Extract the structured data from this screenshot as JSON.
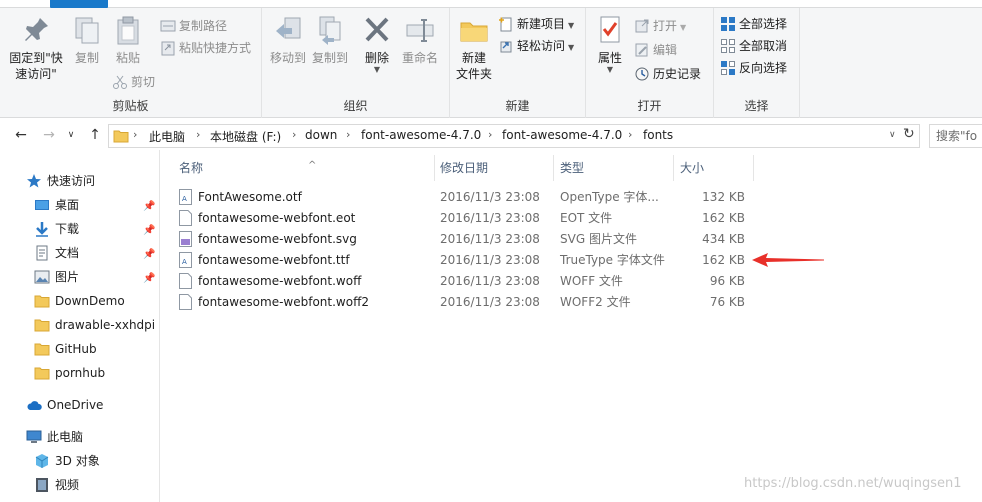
{
  "ribbon": {
    "clipboard": {
      "pin_label_1": "固定到\"快",
      "pin_label_2": "速访问\"",
      "copy_label": "复制",
      "paste_label": "粘贴",
      "copy_path_label": "复制路径",
      "paste_shortcut_label": "粘贴快捷方式",
      "cut_label": "剪切",
      "group_label": "剪贴板"
    },
    "organize": {
      "move_to_label": "移动到",
      "copy_to_label": "复制到",
      "delete_label": "删除",
      "rename_label": "重命名",
      "group_label": "组织"
    },
    "new": {
      "new_folder_label_1": "新建",
      "new_folder_label_2": "文件夹",
      "new_item_label": "新建项目",
      "easy_access_label": "轻松访问",
      "group_label": "新建"
    },
    "open": {
      "properties_label": "属性",
      "open_label": "打开",
      "edit_label": "编辑",
      "history_label": "历史记录",
      "group_label": "打开"
    },
    "select": {
      "select_all_label": "全部选择",
      "select_none_label": "全部取消",
      "invert_label": "反向选择",
      "group_label": "选择"
    }
  },
  "address": {
    "crumbs": [
      "此电脑",
      "本地磁盘 (F:)",
      "down",
      "font-awesome-4.7.0",
      "font-awesome-4.7.0",
      "fonts"
    ],
    "search_placeholder": "搜索\"fo"
  },
  "nav": {
    "quick_access": "快速访问",
    "items": [
      {
        "label": "桌面",
        "pinned": true
      },
      {
        "label": "下载",
        "pinned": true
      },
      {
        "label": "文档",
        "pinned": true
      },
      {
        "label": "图片",
        "pinned": true
      },
      {
        "label": "DownDemo",
        "pinned": false
      },
      {
        "label": "drawable-xxhdpi",
        "pinned": false
      },
      {
        "label": "GitHub",
        "pinned": false
      },
      {
        "label": "pornhub",
        "pinned": false
      }
    ],
    "onedrive": "OneDrive",
    "this_pc": "此电脑",
    "objects3d": "3D 对象",
    "videos": "视频"
  },
  "list": {
    "headers": {
      "name": "名称",
      "date": "修改日期",
      "type": "类型",
      "size": "大小"
    },
    "files": [
      {
        "name": "FontAwesome.otf",
        "date": "2016/11/3 23:08",
        "type": "OpenType 字体...",
        "size": "132 KB",
        "icon": "font-file-icon"
      },
      {
        "name": "fontawesome-webfont.eot",
        "date": "2016/11/3 23:08",
        "type": "EOT 文件",
        "size": "162 KB",
        "icon": "blank-file-icon"
      },
      {
        "name": "fontawesome-webfont.svg",
        "date": "2016/11/3 23:08",
        "type": "SVG 图片文件",
        "size": "434 KB",
        "icon": "svg-file-icon"
      },
      {
        "name": "fontawesome-webfont.ttf",
        "date": "2016/11/3 23:08",
        "type": "TrueType 字体文件",
        "size": "162 KB",
        "icon": "font-file-icon"
      },
      {
        "name": "fontawesome-webfont.woff",
        "date": "2016/11/3 23:08",
        "type": "WOFF 文件",
        "size": "96 KB",
        "icon": "blank-file-icon"
      },
      {
        "name": "fontawesome-webfont.woff2",
        "date": "2016/11/3 23:08",
        "type": "WOFF2 文件",
        "size": "76 KB",
        "icon": "blank-file-icon"
      }
    ]
  },
  "watermark": "https://blog.csdn.net/wuqingsen1",
  "colors": {
    "accent": "#1979ca",
    "annotation_arrow": "#e8302a",
    "folder": "#f3c95b"
  }
}
